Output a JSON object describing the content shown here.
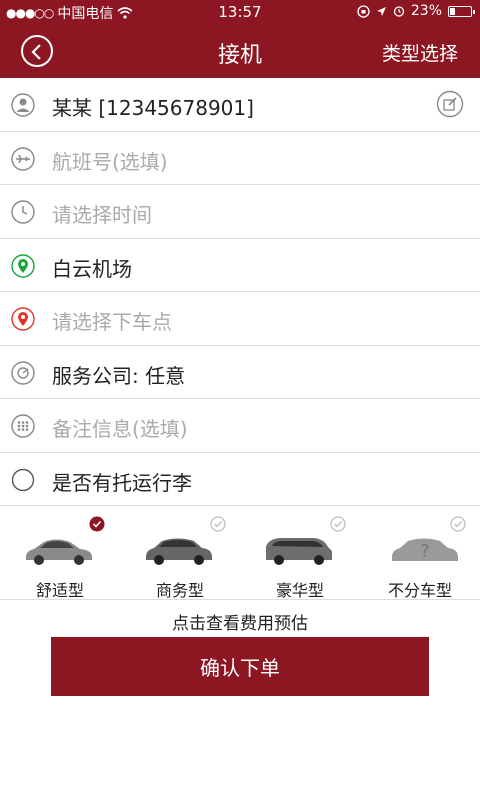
{
  "status_bar": {
    "carrier": "中国电信",
    "time": "13:57",
    "battery_percent": "23%",
    "battery_level": 0.23
  },
  "navbar": {
    "title": "接机",
    "right_action": "类型选择"
  },
  "form": {
    "contact": "某某  [12345678901]",
    "flight_placeholder": "航班号(选填)",
    "time_placeholder": "请选择时间",
    "pickup_airport": "白云机场",
    "dropoff_placeholder": "请选择下车点",
    "service_company": "服务公司:  任意",
    "remark_placeholder": "备注信息(选填)",
    "luggage_label": "是否有托运行李"
  },
  "car_types": [
    {
      "label": "舒适型",
      "selected": true
    },
    {
      "label": "商务型",
      "selected": false
    },
    {
      "label": "豪华型",
      "selected": false
    },
    {
      "label": "不分车型",
      "selected": false
    }
  ],
  "fee_link": "点击查看费用预估",
  "confirm_button": "确认下单",
  "colors": {
    "brand": "#8c1622",
    "location_green": "#19a53b",
    "location_red": "#e0342a"
  }
}
